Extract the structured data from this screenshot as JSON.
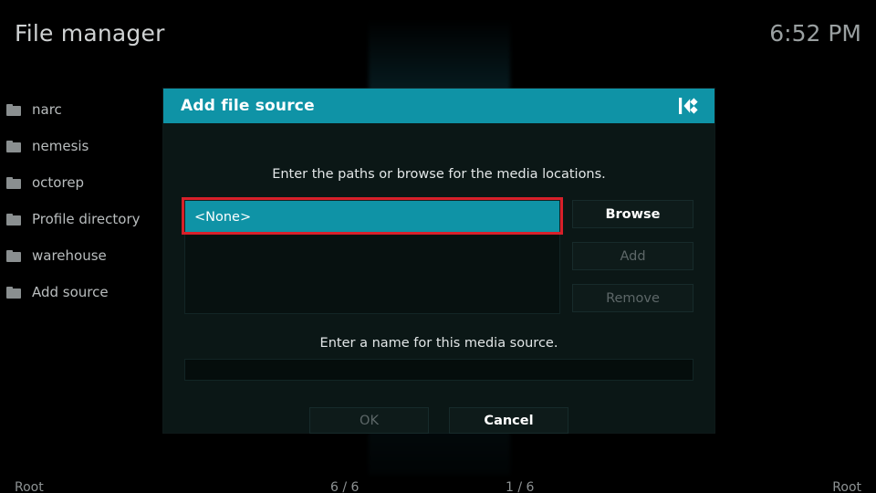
{
  "header": {
    "title": "File manager",
    "clock": "6:52 PM"
  },
  "sidebar": {
    "items": [
      {
        "label": "narc",
        "icon": "folder-icon"
      },
      {
        "label": "nemesis",
        "icon": "folder-icon"
      },
      {
        "label": "octorep",
        "icon": "folder-icon"
      },
      {
        "label": "Profile directory",
        "icon": "folder-icon"
      },
      {
        "label": "warehouse",
        "icon": "folder-icon"
      },
      {
        "label": "Add source",
        "icon": "folder-icon"
      }
    ]
  },
  "status_bar": {
    "left": "Root",
    "mid_left": "6 / 6",
    "mid_right": "1 / 6",
    "right": "Root"
  },
  "dialog": {
    "title": "Add file source",
    "logo_icon": "kodi-logo-icon",
    "hint_paths": "Enter the paths or browse for the media locations.",
    "hint_name": "Enter a name for this media source.",
    "paths": [
      {
        "label": "<None>",
        "selected": true
      }
    ],
    "side_buttons": [
      {
        "label": "Browse",
        "enabled": true
      },
      {
        "label": "Add",
        "enabled": false
      },
      {
        "label": "Remove",
        "enabled": false
      }
    ],
    "name_field": {
      "value": "",
      "placeholder": ""
    },
    "actions": [
      {
        "label": "OK",
        "enabled": false
      },
      {
        "label": "Cancel",
        "enabled": true
      }
    ]
  },
  "colors": {
    "accent_teal": "#0f93a6",
    "annotation_red": "#d8202a",
    "dialog_bg": "#0b1716",
    "panel_bg": "#071110",
    "text_primary": "#ffffff",
    "text_muted": "#5d6768"
  }
}
